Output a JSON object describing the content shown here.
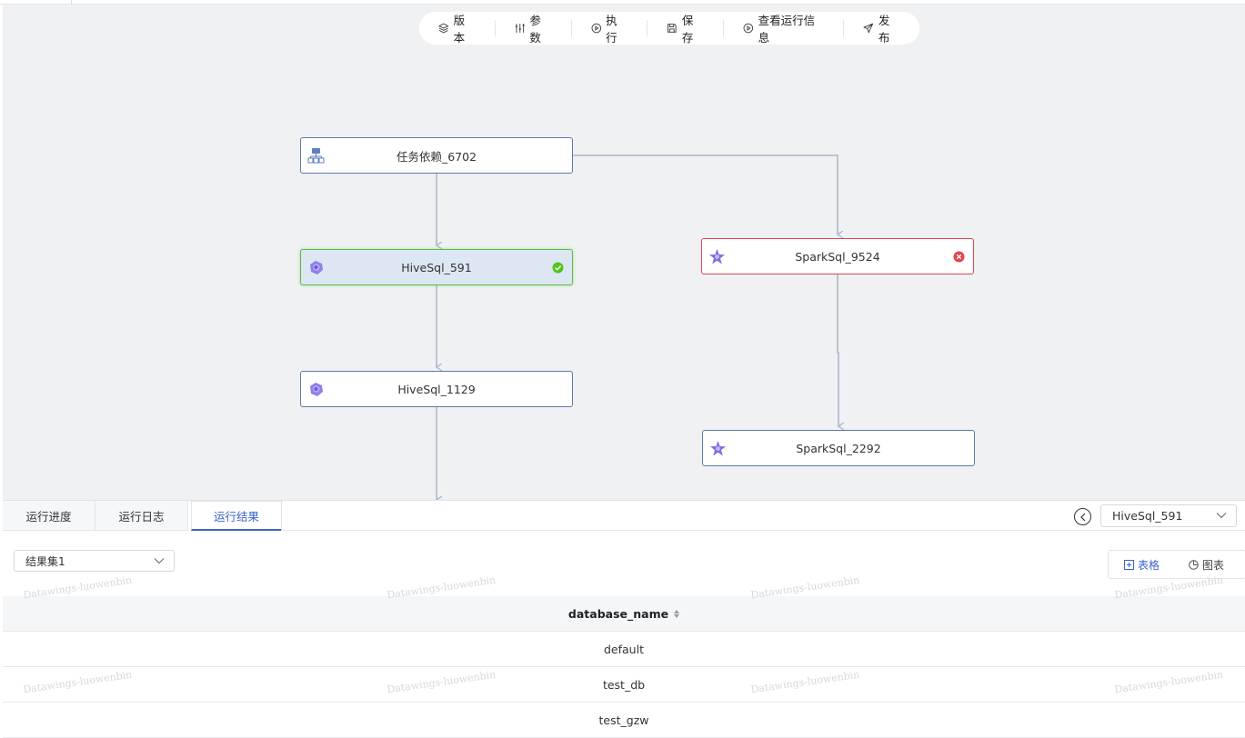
{
  "toolbar": {
    "items": [
      {
        "label": "版本",
        "icon": "layers-icon"
      },
      {
        "label": "参数",
        "icon": "sliders-icon"
      },
      {
        "label": "执行",
        "icon": "play-circle-icon"
      },
      {
        "label": "保存",
        "icon": "save-icon"
      },
      {
        "label": "查看运行信息",
        "icon": "play-circle-icon"
      },
      {
        "label": "发布",
        "icon": "send-icon"
      }
    ]
  },
  "dag": {
    "nodes": [
      {
        "label": "任务依赖_6702",
        "icon": "dependency-icon",
        "status": "none"
      },
      {
        "label": "HiveSql_591",
        "icon": "hive-icon",
        "status": "success"
      },
      {
        "label": "HiveSql_1129",
        "icon": "hive-icon",
        "status": "none"
      },
      {
        "label": "SparkSql_9524",
        "icon": "spark-icon",
        "status": "error"
      },
      {
        "label": "SparkSql_2292",
        "icon": "spark-icon",
        "status": "none"
      }
    ],
    "colors": {
      "edge": "#a9b6c9",
      "selected_border": "#5cbf45",
      "error": "#e0454f",
      "success": "#52c41a"
    }
  },
  "panel": {
    "tabs": [
      "运行进度",
      "运行日志",
      "运行结果"
    ],
    "active_tab": "运行结果",
    "node_selector": "HiveSql_591",
    "result_set": "结果集1",
    "view_modes": [
      "表格",
      "图表"
    ],
    "active_view": "表格",
    "table": {
      "columns": [
        "database_name"
      ],
      "rows": [
        "default",
        "test_db",
        "test_gzw"
      ]
    },
    "watermark": "Datawings-luowenbin"
  },
  "accent": "#3c64c8"
}
